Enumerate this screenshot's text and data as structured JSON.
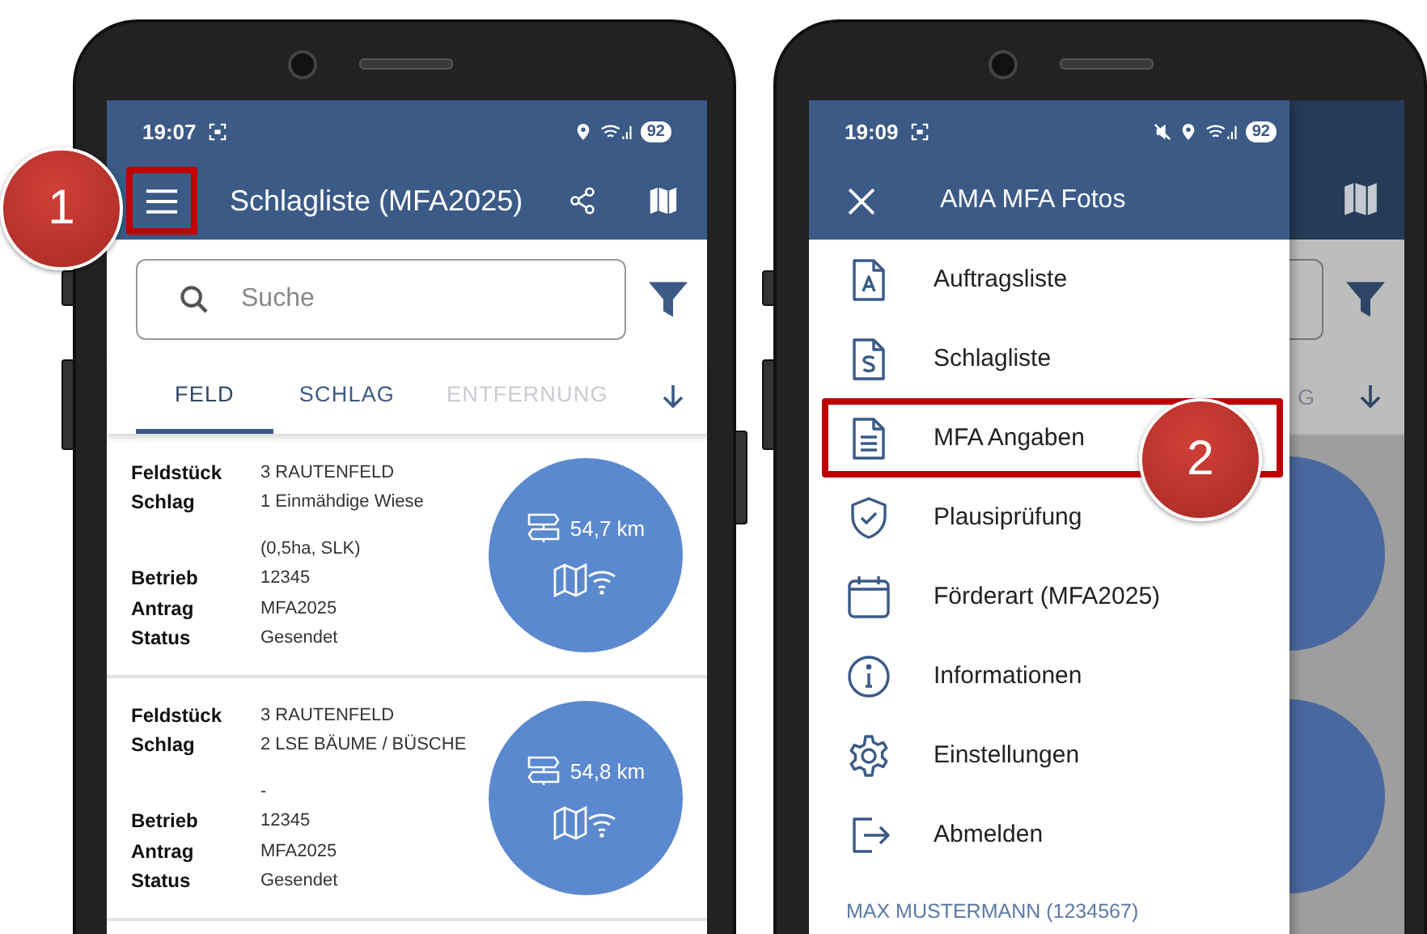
{
  "left_phone": {
    "status_bar": {
      "time": "19:07",
      "battery": "92"
    },
    "app_bar": {
      "title": "Schlagliste (MFA2025)",
      "menu_marker": "1"
    },
    "search": {
      "placeholder": "Suche"
    },
    "tabs": [
      {
        "label": "FELD",
        "selected": true,
        "disabled": false
      },
      {
        "label": "SCHLAG",
        "selected": false,
        "disabled": false
      },
      {
        "label": "ENTFERNUNG",
        "selected": false,
        "disabled": true
      }
    ],
    "cards": [
      {
        "distance": "54,7 km",
        "rows": [
          {
            "kind": "field",
            "label": "Feldstück",
            "value": "3  RAUTENFELD"
          },
          {
            "kind": "field",
            "label": "Schlag",
            "value": "1  Einmähdige Wiese"
          },
          {
            "kind": "note",
            "value": "(0,5ha, SLK)"
          },
          {
            "kind": "field",
            "label": "Betrieb",
            "value": "12345"
          },
          {
            "kind": "field",
            "label": "Antrag",
            "value": "MFA2025"
          },
          {
            "kind": "field",
            "label": "Status",
            "value": "Gesendet"
          }
        ]
      },
      {
        "distance": "54,8 km",
        "rows": [
          {
            "kind": "field",
            "label": "Feldstück",
            "value": "3  RAUTENFELD"
          },
          {
            "kind": "field",
            "label": "Schlag",
            "value": "2  LSE BÄUME / BÜSCHE"
          },
          {
            "kind": "note",
            "value": "-"
          },
          {
            "kind": "field",
            "label": "Betrieb",
            "value": "12345"
          },
          {
            "kind": "field",
            "label": "Antrag",
            "value": "MFA2025"
          },
          {
            "kind": "field",
            "label": "Status",
            "value": "Gesendet"
          }
        ]
      }
    ]
  },
  "right_phone": {
    "status_bar": {
      "time": "19:09",
      "battery": "92"
    },
    "background_tab_fragment": "G",
    "drawer": {
      "title": "AMA MFA Fotos",
      "items": [
        {
          "kind": "doc-a",
          "label": "Auftragsliste"
        },
        {
          "kind": "doc-s",
          "label": "Schlagliste"
        },
        {
          "kind": "doc-lines",
          "label": "MFA Angaben",
          "marker": "2"
        },
        {
          "kind": "shield",
          "label": "Plausiprüfung"
        },
        {
          "kind": "calendar",
          "label": "Förderart (MFA2025)"
        },
        {
          "kind": "info",
          "label": "Informationen"
        },
        {
          "kind": "gear",
          "label": "Einstellungen"
        },
        {
          "kind": "logout",
          "label": "Abmelden"
        }
      ],
      "user": "MAX MUSTERMANN (1234567)"
    }
  }
}
